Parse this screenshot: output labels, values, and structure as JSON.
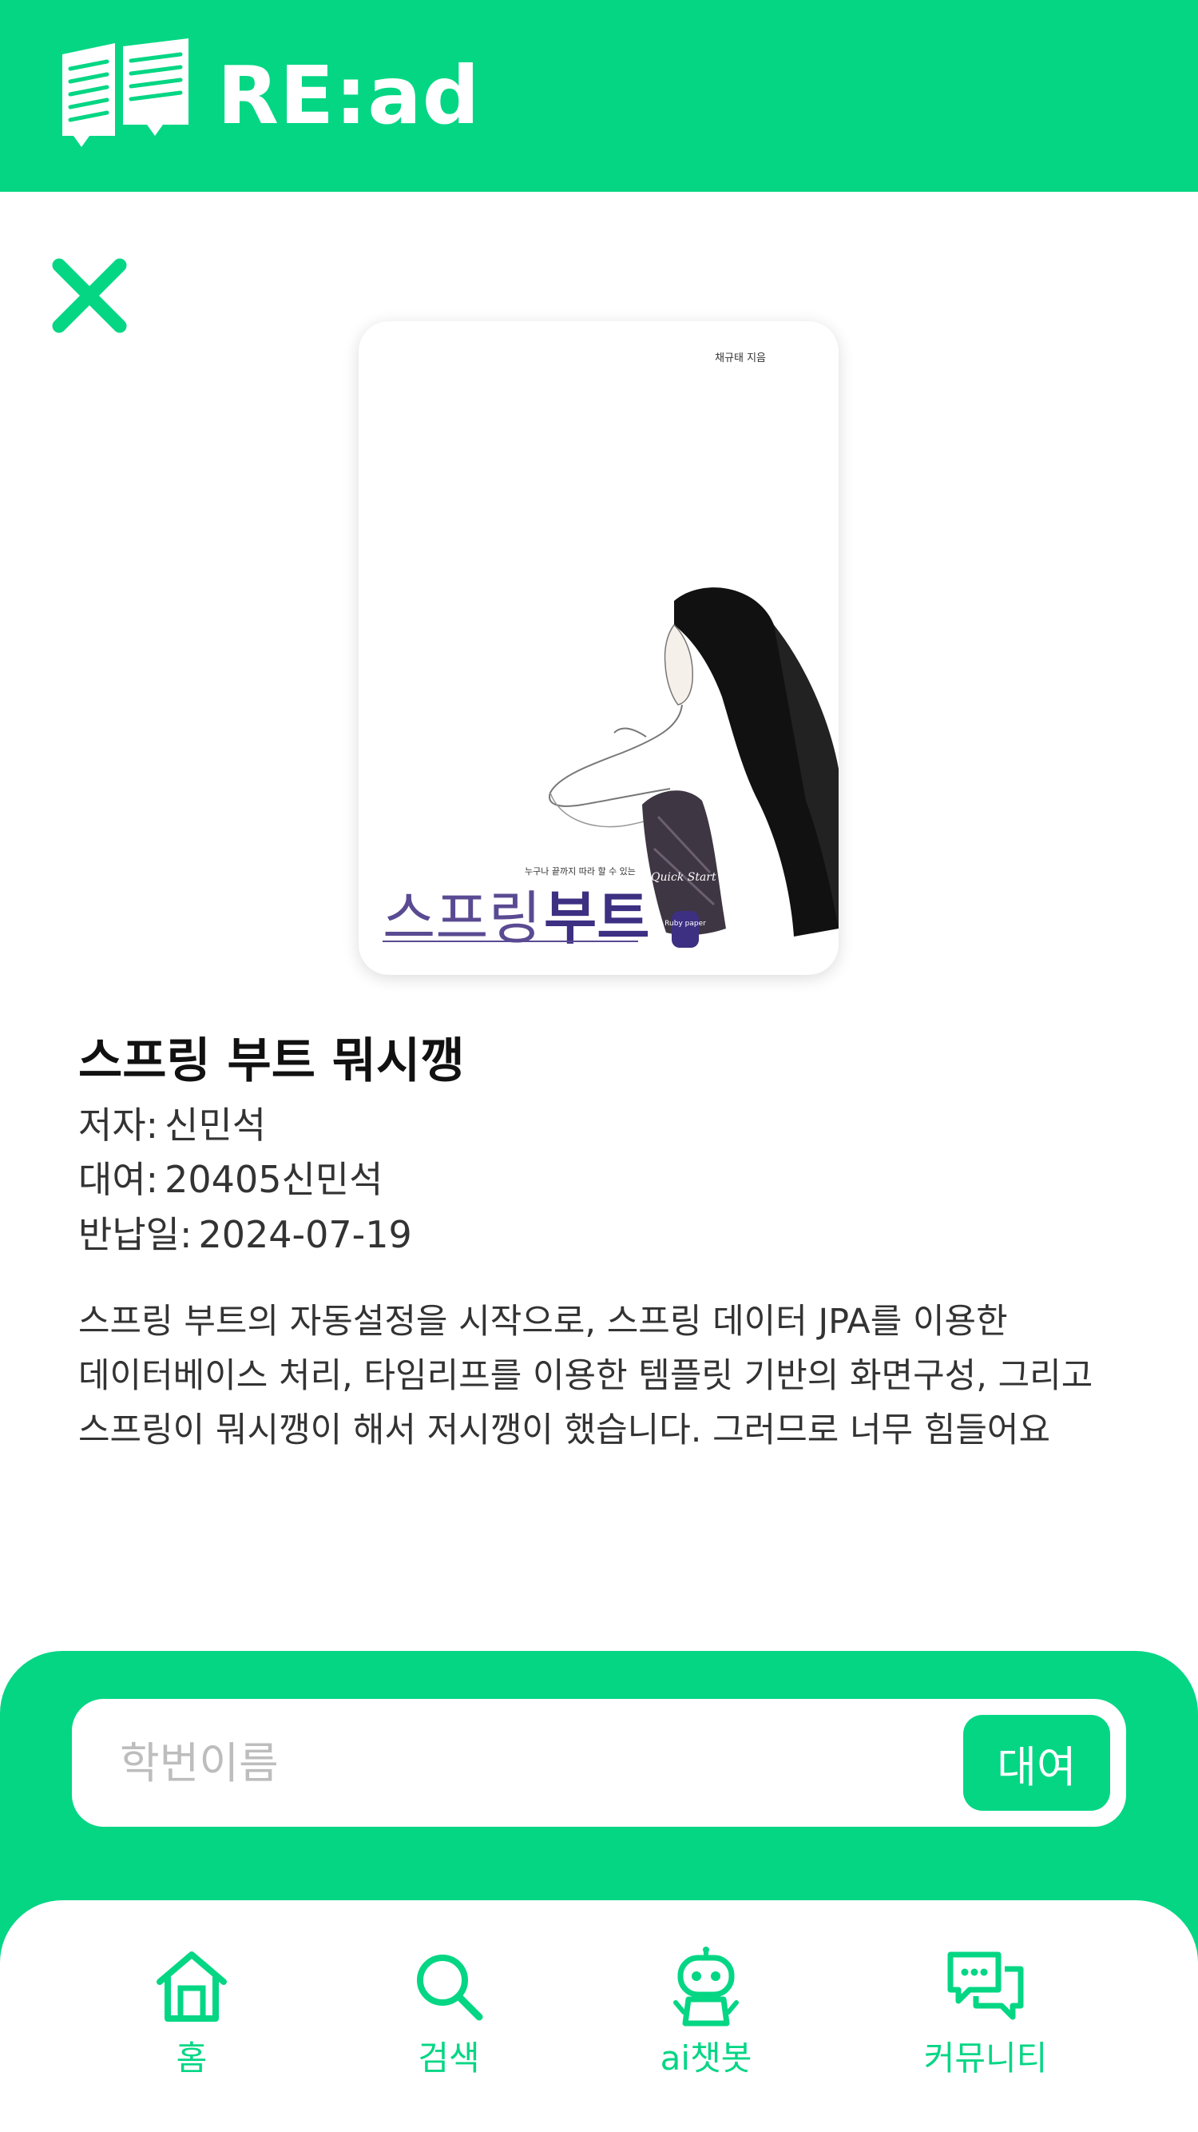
{
  "app": {
    "title": "RE:ad",
    "accent_color": "#04d684",
    "logo_icon": "open-books-icon"
  },
  "toolbar": {
    "close_icon": "close-icon"
  },
  "book": {
    "cover": {
      "title_part1": "스프링",
      "title_part2": "부트",
      "tagline": "누구나 끝까지 따라 할 수 있는",
      "series": "Quick Start",
      "author_credit": "채규태 지음",
      "publisher": "Ruby paper"
    },
    "title": "스프링 부트 뭐시깽",
    "author_label": "저자:",
    "author": "신민석",
    "rental_label": "대여:",
    "rental": "20405신민석",
    "return_label": "반납일:",
    "return_date": "2024-07-19",
    "description": "스프링 부트의 자동설정을 시작으로, 스프링 데이터 JPA를 이용한 데이터베이스 처리, 타임리프를 이용한 템플릿 기반의 화면구성, 그리고 스프링이 뭐시깽이 해서 저시깽이 했습니다. 그러므로 너무 힘들어요"
  },
  "rent_form": {
    "placeholder": "학번이름",
    "value": "",
    "button_label": "대여"
  },
  "nav": {
    "items": [
      {
        "label": "홈",
        "icon": "home-icon"
      },
      {
        "label": "검색",
        "icon": "search-icon"
      },
      {
        "label": "ai챗봇",
        "icon": "robot-icon"
      },
      {
        "label": "커뮤니티",
        "icon": "chat-bubbles-icon"
      }
    ]
  }
}
